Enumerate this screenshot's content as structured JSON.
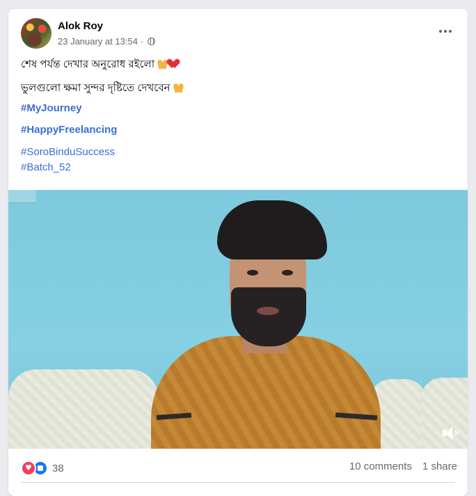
{
  "post": {
    "author": "Alok Roy",
    "timestamp": "23 January at 13:54 ·",
    "privacy_icon": "globe-icon",
    "more_icon": "more-options-icon",
    "lines": [
      "শেষ পর্যন্ত দেখার অনুরোধ রইলো",
      "ভুলগুলো ক্ষমা সুন্দর দৃষ্টিতে দেখবেন"
    ],
    "hashtags": [
      "#MyJourney",
      "#HappyFreelancing",
      "#SoroBinduSuccess",
      "#Batch_52"
    ]
  },
  "video": {
    "mute_icon": "speaker-muted-icon"
  },
  "footer": {
    "reactions_count": "38",
    "comments": "10 comments",
    "shares": "1 share"
  },
  "colors": {
    "hashtag": "#3b6ed6",
    "secondary_text": "#65676b",
    "like_blue": "#1877f2",
    "love_red": "#f33e58"
  }
}
